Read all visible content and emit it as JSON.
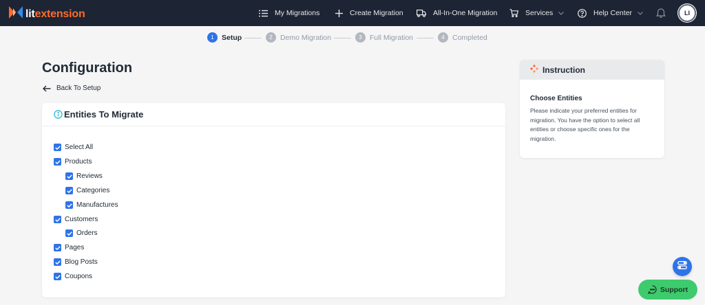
{
  "brand": {
    "part1": "lit",
    "part2": "extension"
  },
  "nav": {
    "my_migrations": "My Migrations",
    "create_migration": "Create Migration",
    "all_in_one": "All-In-One Migration",
    "services": "Services",
    "help_center": "Help Center",
    "avatar_initials": "LI"
  },
  "stepper": [
    {
      "num": "1",
      "label": "Setup",
      "active": true
    },
    {
      "num": "2",
      "label": "Demo Migration",
      "active": false
    },
    {
      "num": "3",
      "label": "Full Migration",
      "active": false
    },
    {
      "num": "4",
      "label": "Completed",
      "active": false
    }
  ],
  "page": {
    "title": "Configuration",
    "back_label": "Back To Setup"
  },
  "entities": {
    "title": "Entities To Migrate",
    "items": [
      {
        "label": "Select All",
        "checked": true
      },
      {
        "label": "Products",
        "checked": true
      },
      {
        "label": "Reviews",
        "checked": true
      },
      {
        "label": "Categories",
        "checked": true
      },
      {
        "label": "Manufactures",
        "checked": true
      },
      {
        "label": "Customers",
        "checked": true
      },
      {
        "label": "Orders",
        "checked": true
      },
      {
        "label": "Pages",
        "checked": true
      },
      {
        "label": "Blog Posts",
        "checked": true
      },
      {
        "label": "Coupons",
        "checked": true
      }
    ]
  },
  "instruction": {
    "title": "Instruction",
    "subtitle": "Choose Entities",
    "text": "Please indicate your preferred entities for migration. You have the option to select all entities or choose specific ones for the migration."
  },
  "support": {
    "label": "Support"
  },
  "colors": {
    "nav_bg": "#1d2433",
    "accent": "#2e74e8",
    "brand_orange": "#ff6b2c",
    "support_green": "#3ecb6d"
  },
  "icons": {
    "logo": "litextension-logo-icon",
    "my_migrations": "list-icon",
    "create_migration": "plus-icon",
    "all_in_one": "truck-icon",
    "services": "cart-icon",
    "help_center": "help-circle-icon",
    "notifications": "bell-icon",
    "back": "arrow-left-icon",
    "entities": "info-icon",
    "instruction": "instruction-dots-icon",
    "fab": "toggle-icon",
    "support": "chat-icon"
  }
}
